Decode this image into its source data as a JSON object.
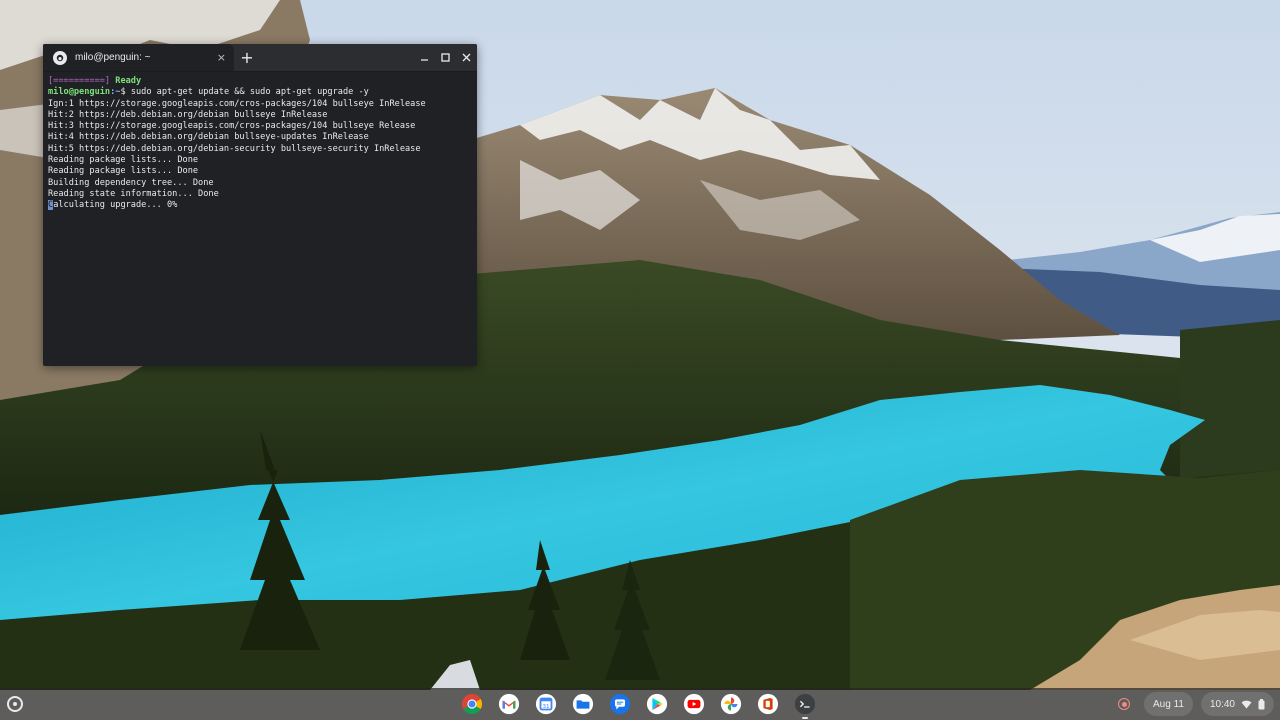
{
  "terminal": {
    "tab_title": "milo@penguin: ~",
    "tab_close": "×",
    "new_tab": "+",
    "minimize": "—",
    "maximize": "□",
    "close": "✕",
    "status_bracket": "[==========]",
    "status_ready": "Ready",
    "prompt_user": "milo@penguin",
    "prompt_path": ":~",
    "prompt_symbol": "$",
    "command": " sudo apt-get update && sudo apt-get upgrade -y",
    "output_lines": [
      "Ign:1 https://storage.googleapis.com/cros-packages/104 bullseye InRelease",
      "Hit:2 https://deb.debian.org/debian bullseye InRelease",
      "Hit:3 https://storage.googleapis.com/cros-packages/104 bullseye Release",
      "Hit:4 https://deb.debian.org/debian bullseye-updates InRelease",
      "Hit:5 https://deb.debian.org/debian-security bullseye-security InRelease",
      "Reading package lists... Done",
      "Reading package lists... Done",
      "Building dependency tree... Done",
      "Reading state information... Done"
    ],
    "last_line_first_char": "C",
    "last_line_rest": "alculating upgrade... 0%"
  },
  "shelf": {
    "apps": [
      {
        "icon": "chrome-icon",
        "active": false
      },
      {
        "icon": "gmail-icon",
        "active": false
      },
      {
        "icon": "calendar-icon",
        "active": false
      },
      {
        "icon": "files-icon",
        "active": false
      },
      {
        "icon": "messages-icon",
        "active": false
      },
      {
        "icon": "play-store-icon",
        "active": false
      },
      {
        "icon": "youtube-icon",
        "active": false
      },
      {
        "icon": "photos-icon",
        "active": false
      },
      {
        "icon": "office-icon",
        "active": false
      },
      {
        "icon": "terminal-icon",
        "active": true
      }
    ],
    "date": "Aug 11",
    "time": "10:40"
  },
  "colors": {
    "terminal_bg": "#202124",
    "prompt_green": "#7be07b",
    "prompt_blue": "#8ab4f8",
    "progress_purple": "#b26cc8",
    "lake": "#2ec3dc"
  }
}
